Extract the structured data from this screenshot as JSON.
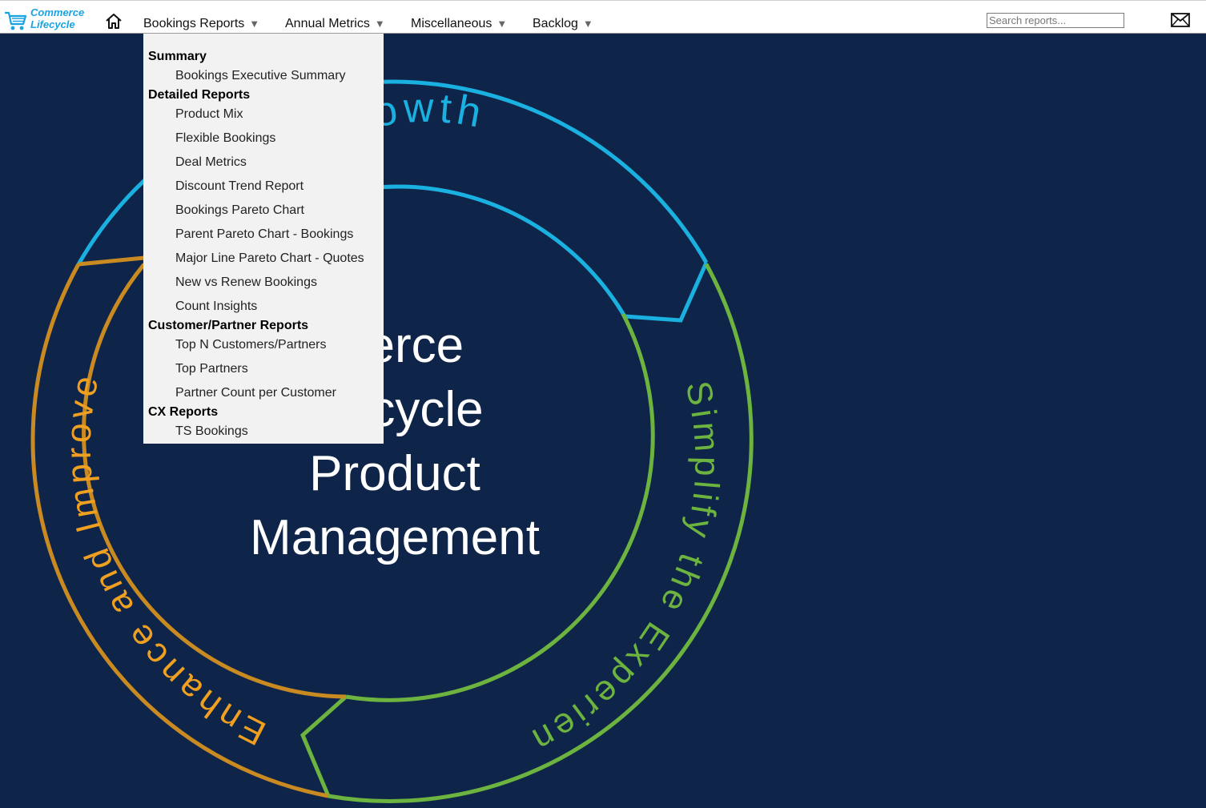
{
  "logo": {
    "line1": "Commerce",
    "line2": "Lifecycle"
  },
  "nav": {
    "home_icon": "home-icon",
    "items": [
      {
        "label": "Bookings Reports",
        "arrow": "▼"
      },
      {
        "label": "Annual Metrics",
        "arrow": "▼"
      },
      {
        "label": "Miscellaneous",
        "arrow": "▼"
      },
      {
        "label": "Backlog",
        "arrow": "▼"
      }
    ]
  },
  "search": {
    "placeholder": "Search reports..."
  },
  "mail_icon": "envelope-icon",
  "dropdown": {
    "sections": [
      {
        "heading": "Summary",
        "items": [
          "Bookings Executive Summary"
        ]
      },
      {
        "heading": "Detailed Reports",
        "items": [
          "Product Mix",
          "Flexible Bookings",
          "Deal Metrics",
          "Discount Trend Report",
          "Bookings Pareto Chart",
          "Parent Pareto Chart - Bookings",
          "Major Line Pareto Chart - Quotes",
          "New vs Renew Bookings",
          "Count Insights"
        ]
      },
      {
        "heading": "Customer/Partner Reports",
        "items": [
          "Top N Customers/Partners",
          "Top Partners",
          "Partner Count per Customer"
        ]
      },
      {
        "heading": "CX Reports",
        "items": [
          "TS Bookings"
        ]
      }
    ]
  },
  "diagram": {
    "center_lines": [
      "merce",
      "cycle",
      "Product",
      "Management"
    ],
    "arcs": [
      {
        "label": "te Growth",
        "color": "#1ab0e0"
      },
      {
        "label": "Simplify the Experience",
        "color": "#6db33f"
      },
      {
        "label": "Enhance and Improve",
        "color": "#d8901f"
      }
    ]
  }
}
